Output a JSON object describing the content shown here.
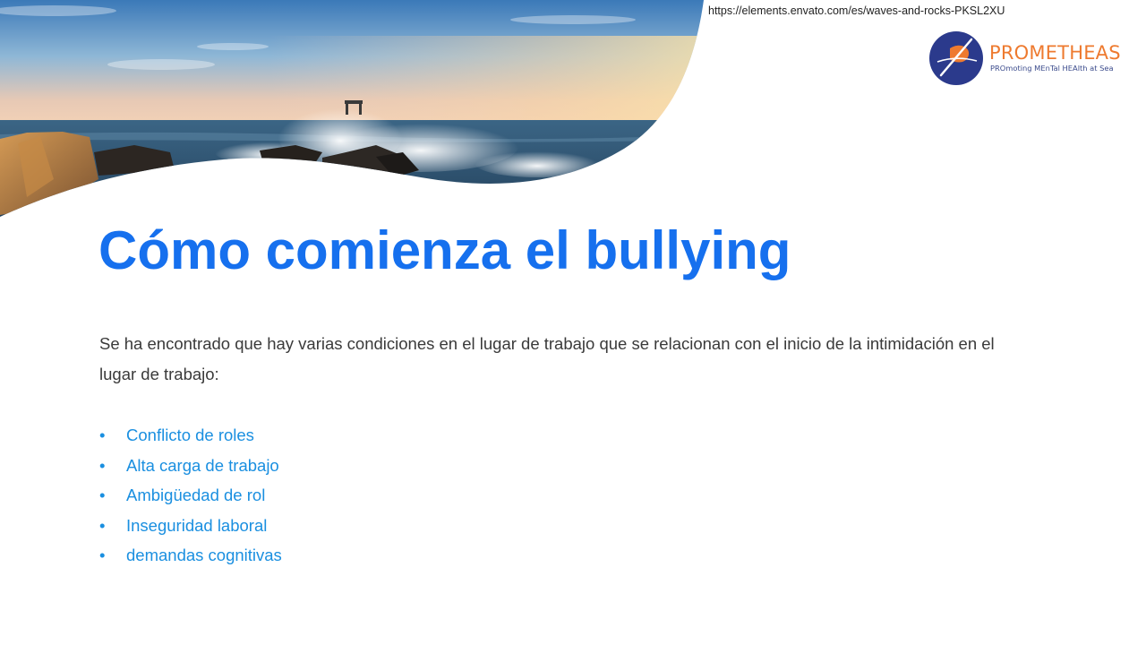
{
  "source_url": "https://elements.envato.com/es/waves-and-rocks-PKSL2XU",
  "logo": {
    "name": "PROMETHEAS",
    "tagline": "PROmoting MEnTal HEAlth at Sea",
    "icon": "prometheas-logo-icon",
    "colors": {
      "circle": "#2b3a8c",
      "accent": "#ee7a2f"
    }
  },
  "slide": {
    "title": "Cómo comienza el bullying",
    "intro": "Se ha encontrado que hay varias condiciones en el lugar de trabajo que se relacionan con el inicio de la intimidación en el lugar de trabajo:",
    "bullet_symbol": "•",
    "bullets": [
      "Conflicto de roles",
      "Alta carga de trabajo",
      "Ambigüedad de rol",
      "Inseguridad laboral",
      "demandas cognitivas"
    ]
  },
  "colors": {
    "title": "#1670ee",
    "bullets": "#1a8fe0",
    "body_text": "#3a3a3a"
  }
}
